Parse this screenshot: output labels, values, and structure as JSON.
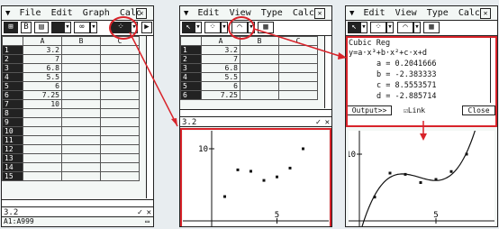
{
  "screen1": {
    "menu": [
      "File",
      "Edit",
      "Graph",
      "Calc"
    ],
    "columns": [
      "A",
      "B",
      "C"
    ],
    "rows": [
      {
        "n": "1",
        "a": "3.2"
      },
      {
        "n": "2",
        "a": "7"
      },
      {
        "n": "3",
        "a": "6.8"
      },
      {
        "n": "4",
        "a": "5.5"
      },
      {
        "n": "5",
        "a": "6"
      },
      {
        "n": "6",
        "a": "7.25"
      },
      {
        "n": "7",
        "a": "10"
      },
      {
        "n": "8",
        "a": ""
      },
      {
        "n": "9",
        "a": ""
      },
      {
        "n": "10",
        "a": ""
      },
      {
        "n": "11",
        "a": ""
      },
      {
        "n": "12",
        "a": ""
      },
      {
        "n": "13",
        "a": ""
      },
      {
        "n": "14",
        "a": ""
      },
      {
        "n": "15",
        "a": ""
      }
    ],
    "edit_value": "3.2",
    "status": "A1:A999",
    "toolbar_b": "B"
  },
  "screen2": {
    "menu": [
      "Edit",
      "View",
      "Type",
      "Calc"
    ],
    "columns": [
      "A",
      "B",
      "C"
    ],
    "rows": [
      {
        "n": "1",
        "a": "3.2"
      },
      {
        "n": "2",
        "a": "7"
      },
      {
        "n": "3",
        "a": "6.8"
      },
      {
        "n": "4",
        "a": "5.5"
      },
      {
        "n": "5",
        "a": "6"
      },
      {
        "n": "6",
        "a": "7.25"
      }
    ],
    "edit_value": "3.2",
    "graph_y_label": "10",
    "graph_x_label": "5",
    "points": [
      [
        1,
        3.2
      ],
      [
        2,
        7
      ],
      [
        3,
        6.8
      ],
      [
        4,
        5.5
      ],
      [
        5,
        6
      ],
      [
        6,
        7.25
      ],
      [
        7,
        10
      ]
    ]
  },
  "screen3": {
    "menu": [
      "Edit",
      "View",
      "Type",
      "Calc"
    ],
    "title": "Cubic Reg",
    "formula": "y=a·x³+b·x²+c·x+d",
    "a": "a = 0.2041666",
    "b": "b = -2.383333",
    "c": "c = 8.5553571",
    "d": "d = -2.885714",
    "output_button": "Output>>",
    "link_label": "☑Link",
    "close_button": "Close",
    "graph_y_label": "10",
    "graph_x_label": "5"
  },
  "colors": {
    "accent": "#d8232a",
    "screen_bg": "#f3f7f5"
  }
}
